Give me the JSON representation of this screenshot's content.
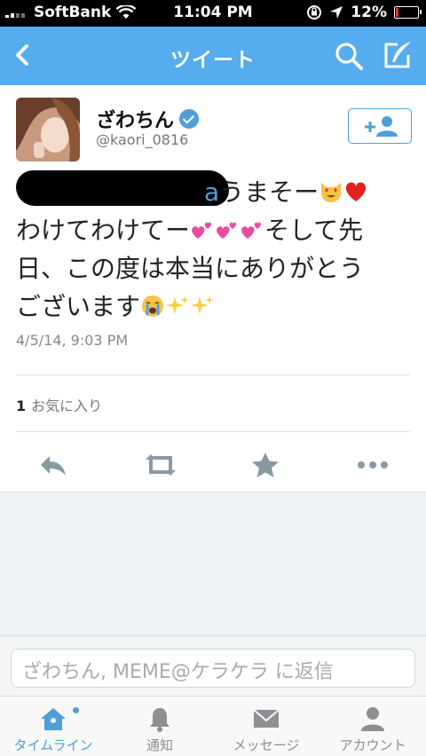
{
  "status_bar": {
    "carrier": "SoftBank",
    "time": "11:04 PM",
    "battery_text": "12%",
    "battery_level": 0.12
  },
  "nav": {
    "title": "ツイート",
    "back_icon": "chevron-left-icon",
    "search_icon": "search-icon",
    "compose_icon": "compose-icon"
  },
  "tweet": {
    "display_name": "ざわちん",
    "handle": "@kaori_0816",
    "line1_fragment": "a",
    "line1_text": "うまそー",
    "line2_text": "わけてわけてー",
    "line2_text_after": "そして先",
    "line3_text": "日、この度は本当にありがとう",
    "line4_text": "ございます",
    "timestamp": "4/5/14, 9:03 PM",
    "favorites_count": "1",
    "favorites_label": "お気に入り"
  },
  "reply": {
    "placeholder": "ざわちん, MEME@ケラケラ に返信"
  },
  "tabs": [
    {
      "label": "タイムライン",
      "icon": "home-icon",
      "active": true
    },
    {
      "label": "通知",
      "icon": "bell-icon",
      "active": false
    },
    {
      "label": "メッセージ",
      "icon": "envelope-icon",
      "active": false
    },
    {
      "label": "アカウント",
      "icon": "person-icon",
      "active": false
    }
  ],
  "colors": {
    "brand_blue": "#55acee",
    "link_blue": "#4e9fd8",
    "battery_low": "#e33333"
  }
}
